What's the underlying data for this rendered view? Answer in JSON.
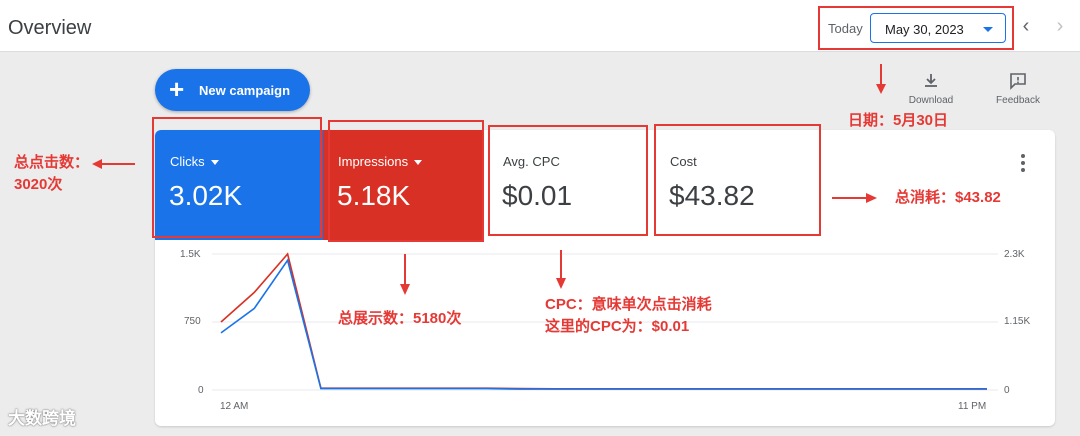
{
  "header": {
    "title": "Overview",
    "today_label": "Today",
    "date_value": "May 30, 2023"
  },
  "actions": {
    "new_campaign_label": "New campaign",
    "download_label": "Download",
    "feedback_label": "Feedback"
  },
  "metrics": [
    {
      "name": "Clicks",
      "value": "3.02K"
    },
    {
      "name": "Impressions",
      "value": "5.18K"
    },
    {
      "name": "Avg. CPC",
      "value": "$0.01"
    },
    {
      "name": "Cost",
      "value": "$43.82"
    }
  ],
  "chart_data": {
    "type": "line",
    "x_tick_labels": [
      "12 AM",
      "11 PM"
    ],
    "y_left_ticks": [
      "1.5K",
      "750",
      "0"
    ],
    "y_right_ticks": [
      "2.3K",
      "1.15K",
      "0"
    ],
    "ylim_left": [
      0,
      1500
    ],
    "ylim_right": [
      0,
      2300
    ],
    "x": [
      0,
      1,
      2,
      3,
      4,
      5,
      6,
      7,
      8,
      9,
      10,
      11,
      12,
      13,
      14,
      15,
      16,
      17,
      18,
      19,
      20,
      21,
      22,
      23
    ],
    "series": [
      {
        "axis": "left",
        "color": "#1a73e8",
        "values": [
          630,
          900,
          1430,
          15,
          15,
          15,
          15,
          15,
          15,
          10,
          10,
          10,
          10,
          10,
          10,
          10,
          10,
          10,
          10,
          10,
          10,
          10,
          10,
          10
        ]
      },
      {
        "axis": "right",
        "color": "#d93025",
        "values": [
          1150,
          1650,
          2300,
          30,
          30,
          30,
          30,
          30,
          30,
          25,
          20,
          20,
          20,
          20,
          20,
          20,
          20,
          20,
          20,
          20,
          20,
          20,
          20,
          20
        ]
      }
    ]
  },
  "annotations": {
    "date_note": "日期：5月30日",
    "clicks_note_line1": "总点击数：",
    "clicks_note_line2": "3020次",
    "impressions_note": "总展示数：5180次",
    "cpc_note_line1": "CPC：意味单次点击消耗",
    "cpc_note_line2": "这里的CPC为：$0.01",
    "cost_note": "总消耗：$43.82"
  },
  "watermark": "大数跨境",
  "colors": {
    "accent": "#1a73e8",
    "clicks": "#1a73e8",
    "impressions": "#d93025",
    "annotation": "#e53935"
  }
}
